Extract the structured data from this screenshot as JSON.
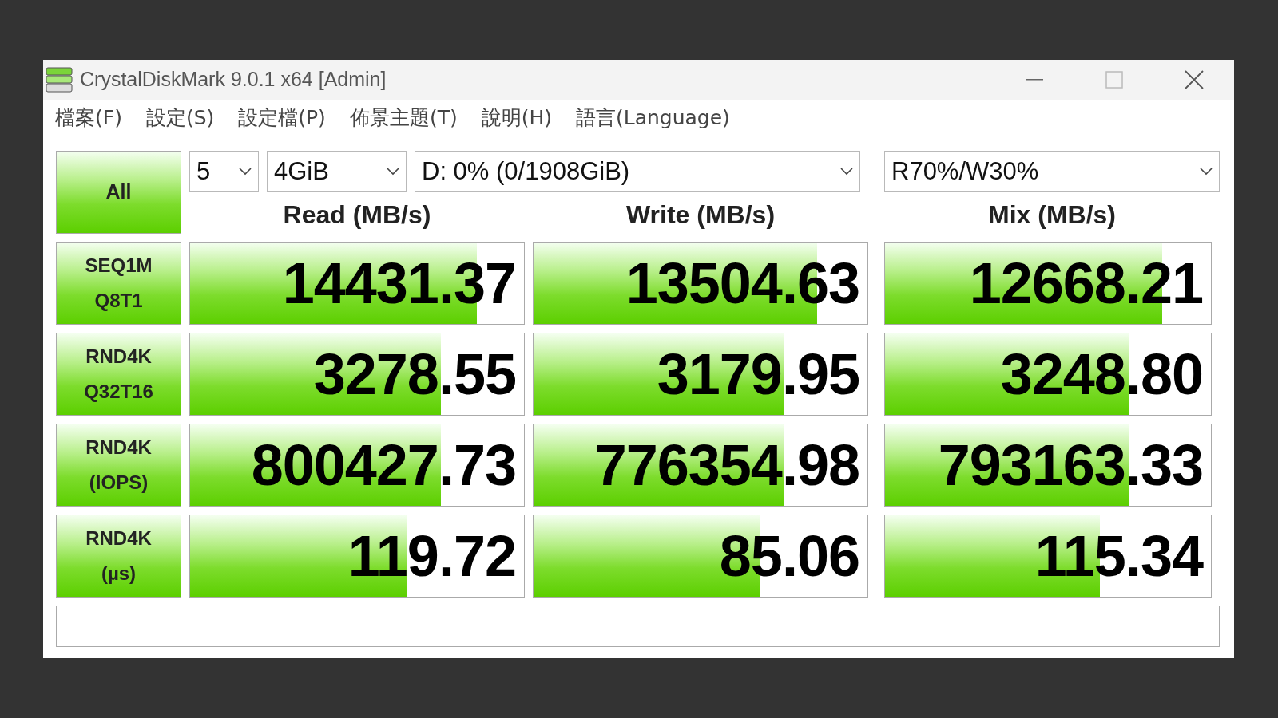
{
  "window": {
    "title": "CrystalDiskMark 9.0.1 x64 [Admin]"
  },
  "menu": [
    "檔案(F)",
    "設定(S)",
    "設定檔(P)",
    "佈景主題(T)",
    "說明(H)",
    "語言(Language)"
  ],
  "controls": {
    "all_button": "All",
    "count": "5",
    "size": "4GiB",
    "drive": "D: 0% (0/1908GiB)",
    "mix_ratio": "R70%/W30%"
  },
  "columns": [
    "Read (MB/s)",
    "Write (MB/s)",
    "Mix (MB/s)"
  ],
  "rows": [
    {
      "label": [
        "SEQ1M",
        "Q8T1"
      ],
      "cells": [
        {
          "value": "14431.37",
          "level": 0.86
        },
        {
          "value": "13504.63",
          "level": 0.85
        },
        {
          "value": "12668.21",
          "level": 0.85
        }
      ]
    },
    {
      "label": [
        "RND4K",
        "Q32T16"
      ],
      "cells": [
        {
          "value": "3278.55",
          "level": 0.75
        },
        {
          "value": "3179.95",
          "level": 0.75
        },
        {
          "value": "3248.80",
          "level": 0.75
        }
      ]
    },
    {
      "label": [
        "RND4K",
        "(IOPS)"
      ],
      "cells": [
        {
          "value": "800427.73",
          "level": 0.75
        },
        {
          "value": "776354.98",
          "level": 0.75
        },
        {
          "value": "793163.33",
          "level": 0.75
        }
      ]
    },
    {
      "label": [
        "RND4K",
        "(µs)"
      ],
      "cells": [
        {
          "value": "119.72",
          "level": 0.65
        },
        {
          "value": "85.06",
          "level": 0.68
        },
        {
          "value": "115.34",
          "level": 0.66
        }
      ]
    }
  ]
}
